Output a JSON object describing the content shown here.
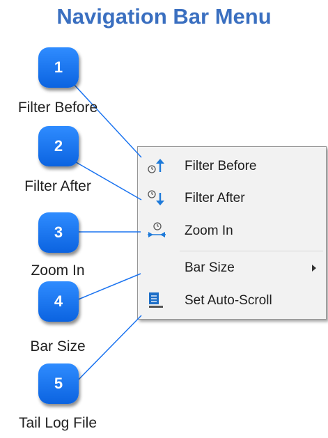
{
  "title": "Navigation Bar Menu",
  "callouts": [
    {
      "number": "1",
      "label": "Filter Before"
    },
    {
      "number": "2",
      "label": "Filter After"
    },
    {
      "number": "3",
      "label": "Zoom In"
    },
    {
      "number": "4",
      "label": "Bar Size"
    },
    {
      "number": "5",
      "label": "Tail Log File"
    }
  ],
  "menu": {
    "items": [
      {
        "label": "Filter Before",
        "icon": "clock-up-arrow-icon"
      },
      {
        "label": "Filter After",
        "icon": "clock-down-arrow-icon"
      },
      {
        "label": "Zoom In",
        "icon": "clock-zoom-icon"
      },
      {
        "label": "Bar Size",
        "icon": "none",
        "submenu": true
      },
      {
        "label": "Set Auto-Scroll",
        "icon": "auto-scroll-icon"
      }
    ]
  },
  "colors": {
    "title": "#3a6fc0",
    "callout": "#1a73f0",
    "connector": "#1a73f0",
    "menu_bg": "#f2f2f2"
  }
}
